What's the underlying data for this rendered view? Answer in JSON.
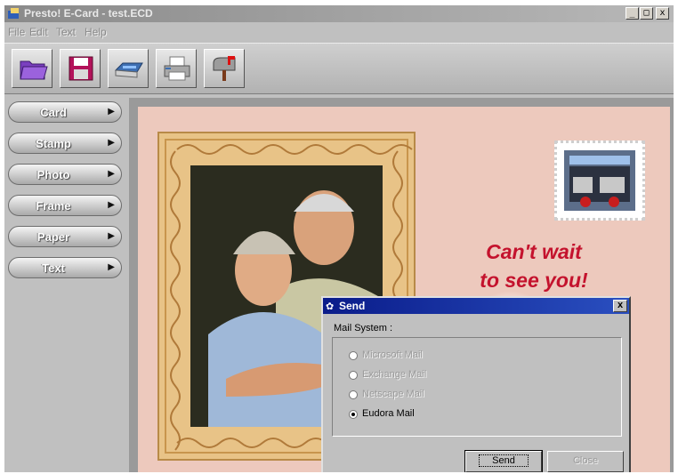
{
  "window": {
    "title": "Presto! E-Card - test.ECD",
    "controls": [
      "_",
      "□",
      "x"
    ]
  },
  "menu": {
    "items": [
      "File",
      "Edit",
      "Text",
      "Help"
    ]
  },
  "toolbar": {
    "buttons": [
      "open-folder-icon",
      "save-disk-icon",
      "scanner-icon",
      "printer-icon",
      "mailbox-icon"
    ]
  },
  "sidebar": {
    "items": [
      {
        "label": "Card",
        "arrow": "▶"
      },
      {
        "label": "Stamp",
        "arrow": "▶"
      },
      {
        "label": "Photo",
        "arrow": "▶"
      },
      {
        "label": "Frame",
        "arrow": "▶"
      },
      {
        "label": "Paper",
        "arrow": "▶"
      },
      {
        "label": "Text",
        "arrow": "▶"
      }
    ]
  },
  "card": {
    "greeting_line1": "Can't wait",
    "greeting_line2": "to see you!"
  },
  "colors": {
    "greeting": "#c4122d",
    "dialog_title": "#0a1c8a",
    "card_paper": "#edc9bd"
  },
  "dialog": {
    "title": "Send",
    "close": "x",
    "mail_system_label": "Mail System :",
    "options": [
      {
        "label": "Microsoft Mail",
        "selected": false,
        "enabled": false
      },
      {
        "label": "Exchange Mail",
        "selected": false,
        "enabled": false
      },
      {
        "label": "Netscape Mail",
        "selected": false,
        "enabled": false
      },
      {
        "label": "Eudora Mail",
        "selected": true,
        "enabled": true
      }
    ],
    "send_label": "Send",
    "close_label": "Close"
  }
}
